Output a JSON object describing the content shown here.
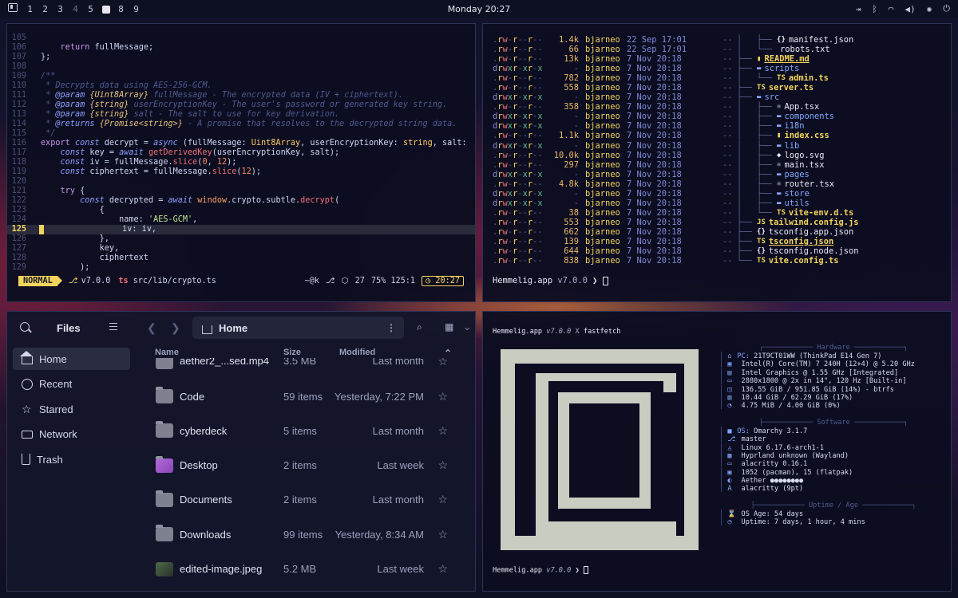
{
  "topbar": {
    "workspaces": [
      "1",
      "2",
      "3",
      "4",
      "5",
      "",
      "8",
      "9"
    ],
    "clock": "Monday 20:27",
    "tray": [
      "logout-icon",
      "bluetooth-icon",
      "wifi-icon",
      "volume-icon",
      "brightness-icon",
      "power-icon"
    ]
  },
  "editor": {
    "lines": [
      {
        "n": "105",
        "t": ""
      },
      {
        "n": "106",
        "t": "    return fullMessage;"
      },
      {
        "n": "107",
        "t": "};"
      },
      {
        "n": "108",
        "t": ""
      },
      {
        "n": "109",
        "t": "/**"
      },
      {
        "n": "110",
        "t": " * Decrypts data using AES-256-GCM."
      },
      {
        "n": "111",
        "t": " * @param {Uint8Array} fullMessage - The encrypted data (IV + ciphertext)."
      },
      {
        "n": "112",
        "t": " * @param {string} userEncryptionKey - The user's password or generated key string."
      },
      {
        "n": "113",
        "t": " * @param {string} salt - The salt to use for key derivation."
      },
      {
        "n": "114",
        "t": " * @returns {Promise<string>} - A promise that resolves to the decrypted string data."
      },
      {
        "n": "115",
        "t": " */"
      },
      {
        "n": "116",
        "t": "export const decrypt = async (fullMessage: Uint8Array, userEncryptionKey: string, salt:"
      },
      {
        "n": "117",
        "t": "    const key = await getDerivedKey(userEncryptionKey, salt);"
      },
      {
        "n": "118",
        "t": "    const iv = fullMessage.slice(0, 12);"
      },
      {
        "n": "119",
        "t": "    const ciphertext = fullMessage.slice(12);"
      },
      {
        "n": "120",
        "t": ""
      },
      {
        "n": "121",
        "t": "    try {"
      },
      {
        "n": "122",
        "t": "        const decrypted = await window.crypto.subtle.decrypt("
      },
      {
        "n": "123",
        "t": "            {"
      },
      {
        "n": "124",
        "t": "                name: 'AES-GCM',"
      },
      {
        "n": "125",
        "t": "                iv: iv,"
      },
      {
        "n": "126",
        "t": "            },"
      },
      {
        "n": "127",
        "t": "            key,"
      },
      {
        "n": "128",
        "t": "            ciphertext"
      },
      {
        "n": "129",
        "t": "        );"
      }
    ],
    "current_line": "125",
    "status": {
      "mode": "NORMAL",
      "version": "v7.0.0",
      "file": "src/lib/crypto.ts",
      "user": "~@k",
      "commits": "27",
      "position": "75% 125:1",
      "time": "20:27"
    }
  },
  "listing": {
    "rows": [
      {
        "perm": ".rw-r--r--",
        "size": "1.4k",
        "user": "bjarneo",
        "date": "22 Sep 17:01",
        "tree": "│   ├── ",
        "icon": "{}",
        "name": "manifest.json",
        "cls": "file"
      },
      {
        "perm": ".rw-r--r--",
        "size": "66",
        "user": "bjarneo",
        "date": "22 Sep 17:01",
        "tree": "│   └── ",
        "icon": "",
        "name": "robots.txt",
        "cls": "file"
      },
      {
        "perm": ".rw-r--r--",
        "size": "13k",
        "user": "bjarneo",
        "date": "7 Nov 20:18",
        "tree": "├── ",
        "icon": "▮",
        "name": "README.md",
        "cls": "yu"
      },
      {
        "perm": "drwxr-xr-x",
        "size": "-",
        "user": "bjarneo",
        "date": "7 Nov 20:18",
        "tree": "├── ",
        "icon": "▬",
        "name": "scripts",
        "cls": "dir"
      },
      {
        "perm": ".rw-r--r--",
        "size": "782",
        "user": "bjarneo",
        "date": "7 Nov 20:18",
        "tree": "│   └── ",
        "icon": "TS",
        "name": "admin.ts",
        "cls": "y"
      },
      {
        "perm": ".rw-r--r--",
        "size": "558",
        "user": "bjarneo",
        "date": "7 Nov 20:18",
        "tree": "├── ",
        "icon": "TS",
        "name": "server.ts",
        "cls": "y"
      },
      {
        "perm": "drwxr-xr-x",
        "size": "-",
        "user": "bjarneo",
        "date": "7 Nov 20:18",
        "tree": "├── ",
        "icon": "▬",
        "name": "src",
        "cls": "dir"
      },
      {
        "perm": ".rw-r--r--",
        "size": "358",
        "user": "bjarneo",
        "date": "7 Nov 20:18",
        "tree": "│   ├── ",
        "icon": "⚛",
        "name": "App.tsx",
        "cls": "file"
      },
      {
        "perm": "drwxr-xr-x",
        "size": "-",
        "user": "bjarneo",
        "date": "7 Nov 20:18",
        "tree": "│   ├── ",
        "icon": "▬",
        "name": "components",
        "cls": "dir"
      },
      {
        "perm": "drwxr-xr-x",
        "size": "-",
        "user": "bjarneo",
        "date": "7 Nov 20:18",
        "tree": "│   ├── ",
        "icon": "▬",
        "name": "i18n",
        "cls": "dir"
      },
      {
        "perm": ".rw-r--r--",
        "size": "1.1k",
        "user": "bjarneo",
        "date": "7 Nov 20:18",
        "tree": "│   ├── ",
        "icon": "▮",
        "name": "index.css",
        "cls": "y"
      },
      {
        "perm": "drwxr-xr-x",
        "size": "-",
        "user": "bjarneo",
        "date": "7 Nov 20:18",
        "tree": "│   ├── ",
        "icon": "▬",
        "name": "lib",
        "cls": "dir"
      },
      {
        "perm": ".rw-r--r--",
        "size": "10.0k",
        "user": "bjarneo",
        "date": "7 Nov 20:18",
        "tree": "│   ├── ",
        "icon": "◆",
        "name": "logo.svg",
        "cls": "file"
      },
      {
        "perm": ".rw-r--r--",
        "size": "297",
        "user": "bjarneo",
        "date": "7 Nov 20:18",
        "tree": "│   ├── ",
        "icon": "⚛",
        "name": "main.tsx",
        "cls": "file"
      },
      {
        "perm": "drwxr-xr-x",
        "size": "-",
        "user": "bjarneo",
        "date": "7 Nov 20:18",
        "tree": "│   ├── ",
        "icon": "▬",
        "name": "pages",
        "cls": "dir"
      },
      {
        "perm": ".rw-r--r--",
        "size": "4.8k",
        "user": "bjarneo",
        "date": "7 Nov 20:18",
        "tree": "│   ├── ",
        "icon": "⚛",
        "name": "router.tsx",
        "cls": "file"
      },
      {
        "perm": "drwxr-xr-x",
        "size": "-",
        "user": "bjarneo",
        "date": "7 Nov 20:18",
        "tree": "│   ├── ",
        "icon": "▬",
        "name": "store",
        "cls": "dir"
      },
      {
        "perm": "drwxr-xr-x",
        "size": "-",
        "user": "bjarneo",
        "date": "7 Nov 20:18",
        "tree": "│   ├── ",
        "icon": "▬",
        "name": "utils",
        "cls": "dir"
      },
      {
        "perm": ".rw-r--r--",
        "size": "38",
        "user": "bjarneo",
        "date": "7 Nov 20:18",
        "tree": "│   └── ",
        "icon": "TS",
        "name": "vite-env.d.ts",
        "cls": "y"
      },
      {
        "perm": ".rw-r--r--",
        "size": "553",
        "user": "bjarneo",
        "date": "7 Nov 20:18",
        "tree": "├── ",
        "icon": "JS",
        "name": "tailwind.config.js",
        "cls": "y"
      },
      {
        "perm": ".rw-r--r--",
        "size": "662",
        "user": "bjarneo",
        "date": "7 Nov 20:18",
        "tree": "├── ",
        "icon": "{}",
        "name": "tsconfig.app.json",
        "cls": "file"
      },
      {
        "perm": ".rw-r--r--",
        "size": "139",
        "user": "bjarneo",
        "date": "7 Nov 20:18",
        "tree": "├── ",
        "icon": "TS",
        "name": "tsconfig.json",
        "cls": "yu"
      },
      {
        "perm": ".rw-r--r--",
        "size": "644",
        "user": "bjarneo",
        "date": "7 Nov 20:18",
        "tree": "├── ",
        "icon": "{}",
        "name": "tsconfig.node.json",
        "cls": "file"
      },
      {
        "perm": ".rw-r--r--",
        "size": "838",
        "user": "bjarneo",
        "date": "7 Nov 20:18",
        "tree": "└── ",
        "icon": "TS",
        "name": "vite.config.ts",
        "cls": "y"
      }
    ],
    "prompt": {
      "host": "Hemmelig.app",
      "version": "v7.0.0",
      "arrow": "❯"
    }
  },
  "files": {
    "title": "Files",
    "sidebar": [
      "Home",
      "Recent",
      "Starred",
      "Network",
      "Trash"
    ],
    "sidebar_icons": [
      "home-icon",
      "clock-icon",
      "star-icon",
      "network-icon",
      "trash-icon"
    ],
    "path": "Home",
    "columns": {
      "name": "Name",
      "size": "Size",
      "modified": "Modified"
    },
    "rows": [
      {
        "name": "aether2_...sed.mp4",
        "size": "3.5 MB",
        "modified": "Last month",
        "icon": "video"
      },
      {
        "name": "Code",
        "size": "59 items",
        "modified": "Yesterday, 7:22 PM",
        "icon": "dir"
      },
      {
        "name": "cyberdeck",
        "size": "5 items",
        "modified": "Last month",
        "icon": "dir"
      },
      {
        "name": "Desktop",
        "size": "2 items",
        "modified": "Last week",
        "icon": "purple"
      },
      {
        "name": "Documents",
        "size": "2 items",
        "modified": "Last month",
        "icon": "dir"
      },
      {
        "name": "Downloads",
        "size": "99 items",
        "modified": "Yesterday, 8:34 AM",
        "icon": "dir"
      },
      {
        "name": "edited-image.jpeg",
        "size": "5.2 MB",
        "modified": "Last week",
        "icon": "img"
      }
    ]
  },
  "fastfetch": {
    "prompt": {
      "host": "Hemmelig.app",
      "version": "v7.0.0",
      "cmd": "fastfetch"
    },
    "hardware_title": "Hardware",
    "hardware": [
      {
        "k": "PC:",
        "v": " 21T9CT01WW (ThinkPad E14 Gen 7)"
      },
      {
        "k": "",
        "v": " Intel(R) Core(TM) 7 240H (12+4) @ 5.20 GHz"
      },
      {
        "k": "",
        "v": " Intel Graphics @ 1.55 GHz [Integrated]"
      },
      {
        "k": "",
        "v": " 2880x1800 @ 2x in 14\", 120 Hz [Built-in]"
      },
      {
        "k": "",
        "v": " 136.55 GiB / 951.85 GiB (14%) - btrfs"
      },
      {
        "k": "",
        "v": " 10.44 GiB / 62.29 GiB (17%)"
      },
      {
        "k": "",
        "v": " 4.75 MiB / 4.00 GiB (0%)"
      }
    ],
    "software_title": "Software",
    "software": [
      {
        "k": "OS:",
        "v": " Omarchy 3.1.7"
      },
      {
        "k": "",
        "v": " master"
      },
      {
        "k": "",
        "v": " Linux 6.17.6-arch1-1"
      },
      {
        "k": "",
        "v": " Hyprland unknown (Wayland)"
      },
      {
        "k": "",
        "v": " alacritty 0.16.1"
      },
      {
        "k": "",
        "v": " 1052 (pacman), 15 (flatpak)"
      },
      {
        "k": "",
        "v": " Aether ●●●●●●●●"
      },
      {
        "k": "",
        "v": " alacritty (9pt)"
      }
    ],
    "uptime_title": "Uptime / Age",
    "uptime": [
      {
        "k": "",
        "v": " OS Age: 54 days"
      },
      {
        "k": "",
        "v": " Uptime: 7 days, 1 hour, 4 mins"
      }
    ],
    "prompt2": {
      "host": "Hemmelig.app",
      "version": "v7.0.0"
    }
  },
  "colors": {
    "accent": "#f2d45c",
    "dir": "#82aaff",
    "comment": "#4f5a90"
  }
}
